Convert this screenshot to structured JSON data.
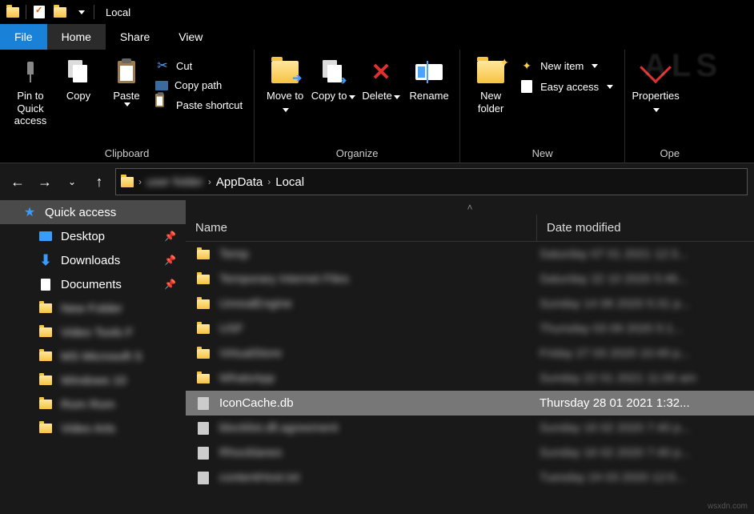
{
  "title": "Local",
  "tabs": {
    "file": "File",
    "home": "Home",
    "share": "Share",
    "view": "View"
  },
  "ribbon": {
    "clipboard": {
      "label": "Clipboard",
      "pin": "Pin to Quick access",
      "copy": "Copy",
      "paste": "Paste",
      "cut": "Cut",
      "copypath": "Copy path",
      "pasteshortcut": "Paste shortcut"
    },
    "organize": {
      "label": "Organize",
      "moveto": "Move to",
      "copyto": "Copy to",
      "delete": "Delete",
      "rename": "Rename"
    },
    "new": {
      "label": "New",
      "newfolder": "New folder",
      "newitem": "New item",
      "easyaccess": "Easy access"
    },
    "open": {
      "label": "Ope",
      "properties": "Properties"
    }
  },
  "breadcrumb": {
    "redacted": "user folder",
    "appdata": "AppData",
    "local": "Local"
  },
  "sidebar": {
    "quick": "Quick access",
    "desktop": "Desktop",
    "downloads": "Downloads",
    "documents": "Documents",
    "blurred": [
      "New Folder",
      "Video Tools F",
      "MS Microsoft S",
      "Windows 10",
      "Rom Rom",
      "Video Arts"
    ]
  },
  "columns": {
    "name": "Name",
    "date": "Date modified"
  },
  "files": {
    "blurred": [
      {
        "name": "Temp",
        "date": "Saturday 07 01 2021 12:3..."
      },
      {
        "name": "Temporary Internet Files",
        "date": "Saturday 22 10 2020 5:46..."
      },
      {
        "name": "UnrealEngine",
        "date": "Sunday 14 06 2020 5:31 p..."
      },
      {
        "name": "USF",
        "date": "Thursday 03 09 2020 5:1..."
      },
      {
        "name": "VirtualStore",
        "date": "Friday 27 03 2020 10:49 p..."
      },
      {
        "name": "WhatsApp",
        "date": "Sunday 22 01 2021 11:00 am"
      }
    ],
    "selected": {
      "name": "IconCache.db",
      "date": "Thursday 28 01 2021 1:32..."
    },
    "blurred2": [
      {
        "name": "blocklist.dll.agreement",
        "date": "Sunday 16 02 2020 7:40 p..."
      },
      {
        "name": "Rhocklanes",
        "date": "Sunday 16 02 2020 7:40 p..."
      },
      {
        "name": "contentHost.txt",
        "date": "Tuesday 24 03 2020 12:0..."
      }
    ]
  },
  "watermark": "wsxdn.com"
}
